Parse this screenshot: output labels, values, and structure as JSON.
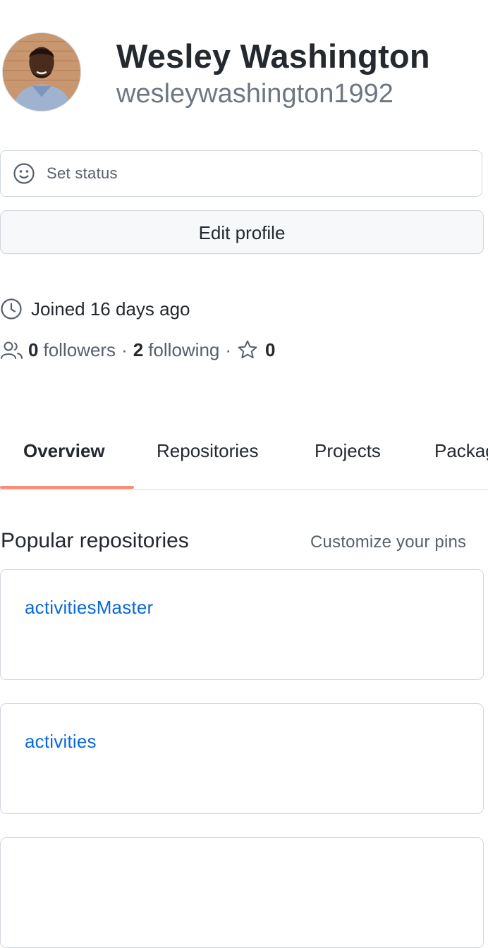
{
  "profile": {
    "full_name": "Wesley Washington",
    "username": "wesleywashington1992"
  },
  "status": {
    "label": "Set status",
    "icon": "smiley-icon"
  },
  "edit_profile_label": "Edit profile",
  "joined": {
    "icon": "clock-icon",
    "text": "Joined 16 days ago"
  },
  "social": {
    "followers_count": "0",
    "followers_label": "followers",
    "following_count": "2",
    "following_label": "following",
    "stars_count": "0",
    "separator": "·"
  },
  "tabs": [
    {
      "label": "Overview",
      "selected": true
    },
    {
      "label": "Repositories",
      "selected": false
    },
    {
      "label": "Projects",
      "selected": false
    },
    {
      "label": "Packages",
      "selected": false
    }
  ],
  "popular": {
    "title": "Popular repositories",
    "customize_label": "Customize your pins",
    "repos": [
      {
        "name": "activitiesMaster"
      },
      {
        "name": "activities"
      }
    ]
  },
  "colors": {
    "link": "#0969da",
    "tab_underline": "#fd8c73",
    "border": "#d0d7de",
    "muted_text": "#57606a"
  }
}
